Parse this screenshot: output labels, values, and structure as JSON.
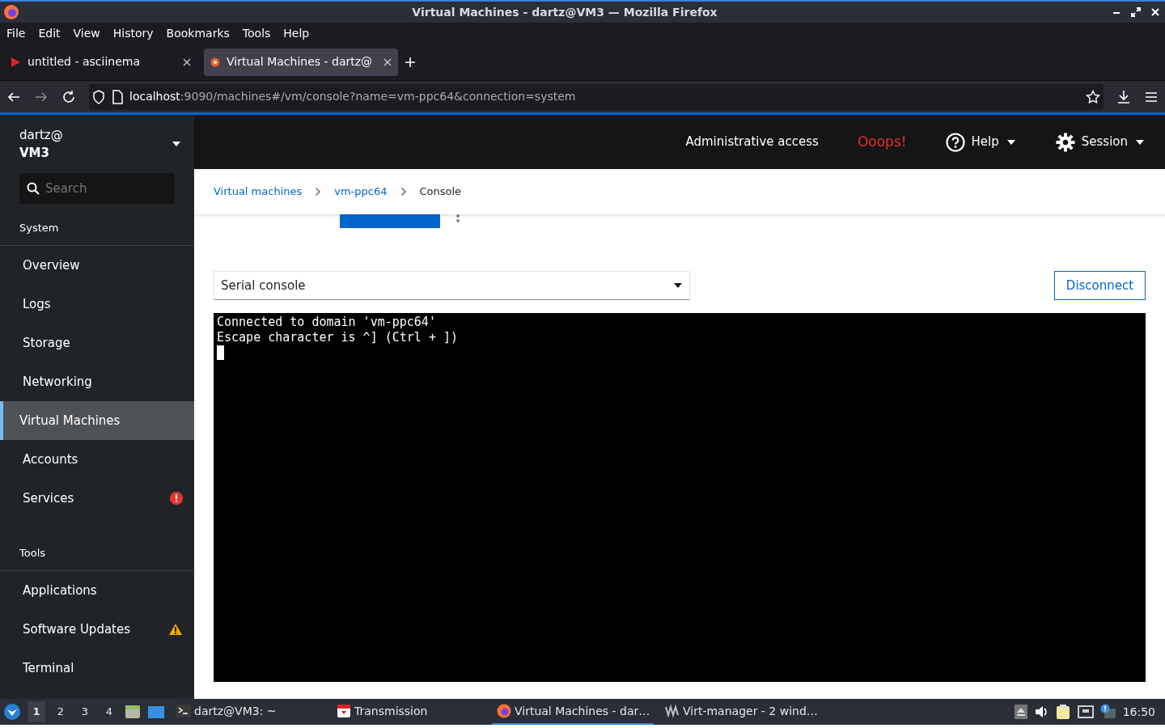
{
  "window": {
    "title": "Virtual Machines - dartz@VM3 — Mozilla Firefox"
  },
  "menu": [
    "File",
    "Edit",
    "View",
    "History",
    "Bookmarks",
    "Tools",
    "Help"
  ],
  "browser_tabs": [
    {
      "label": "untitled - asciinema",
      "kind": "play",
      "selected": false
    },
    {
      "label": "Virtual Machines - dartz@",
      "kind": "cockpit",
      "selected": true
    }
  ],
  "address": {
    "host": "localhost",
    "rest": ":9090/machines#/vm/console?name=vm-ppc64&connection=system"
  },
  "host": {
    "user": "dartz@",
    "name": "VM3"
  },
  "search": {
    "placeholder": "Search"
  },
  "sidebar": [
    {
      "heading": "System",
      "items": [
        {
          "label": "Overview",
          "selected": false
        },
        {
          "label": "Logs",
          "selected": false
        },
        {
          "label": "Storage",
          "selected": false
        },
        {
          "label": "Networking",
          "selected": false
        },
        {
          "label": "Virtual Machines",
          "selected": true
        },
        {
          "label": "Accounts",
          "selected": false
        },
        {
          "label": "Services",
          "selected": false,
          "error": true
        }
      ]
    },
    {
      "heading": "Tools",
      "items": [
        {
          "label": "Applications",
          "selected": false
        },
        {
          "label": "Software Updates",
          "selected": false,
          "warning": true
        },
        {
          "label": "Terminal",
          "selected": false
        }
      ]
    }
  ],
  "masthead": {
    "access": "Administrative access",
    "error": "Ooops!",
    "help": "Help",
    "session": "Session"
  },
  "breadcrumb": [
    {
      "label": "Virtual machines",
      "link": true
    },
    {
      "label": "vm-ppc64",
      "link": true
    },
    {
      "label": "Console",
      "link": false
    }
  ],
  "console_select": "Serial console",
  "disconnect": "Disconnect",
  "terminal_lines": [
    "Connected to domain 'vm-ppc64'",
    "Escape character is ^] (Ctrl + ])"
  ],
  "taskbar": {
    "workspaces": [
      {
        "label": "1",
        "selected": true
      },
      {
        "label": "2",
        "selected": false
      },
      {
        "label": "3",
        "selected": false
      },
      {
        "label": "4",
        "selected": false
      }
    ],
    "tasks": [
      {
        "label": "dartz@VM3: ~",
        "kind": "terminal",
        "selected": false
      },
      {
        "label": "Transmission",
        "kind": "transmission",
        "selected": false
      },
      {
        "label": "Virtual Machines - dar…",
        "kind": "firefox",
        "selected": true
      },
      {
        "label": "Virt-manager - 2 wind…",
        "kind": "virt",
        "selected": false
      }
    ],
    "clock": "16:50"
  }
}
